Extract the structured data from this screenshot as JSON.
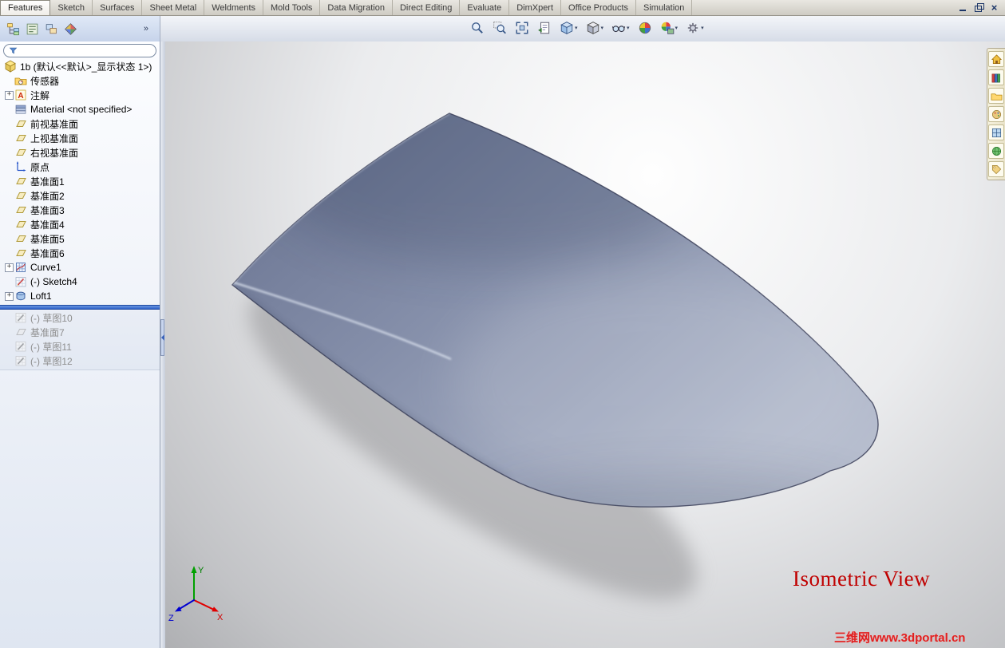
{
  "command_tabs": {
    "items": [
      {
        "label": "Features",
        "active": true
      },
      {
        "label": "Sketch",
        "active": false
      },
      {
        "label": "Surfaces",
        "active": false
      },
      {
        "label": "Sheet Metal",
        "active": false
      },
      {
        "label": "Weldments",
        "active": false
      },
      {
        "label": "Mold Tools",
        "active": false
      },
      {
        "label": "Data Migration",
        "active": false
      },
      {
        "label": "Direct Editing",
        "active": false
      },
      {
        "label": "Evaluate",
        "active": false
      },
      {
        "label": "DimXpert",
        "active": false
      },
      {
        "label": "Office Products",
        "active": false
      },
      {
        "label": "Simulation",
        "active": false
      }
    ]
  },
  "window_controls": {
    "buttons": [
      {
        "name": "minimize-button"
      },
      {
        "name": "restore-button"
      },
      {
        "name": "close-button"
      }
    ]
  },
  "featuremanager_toolbar": {
    "tabs": [
      {
        "name": "featuremanager-design-tree-tab"
      },
      {
        "name": "propertymanager-tab"
      },
      {
        "name": "configurationmanager-tab"
      },
      {
        "name": "displaymanager-tab"
      }
    ],
    "overflow": "»"
  },
  "view_toolbar": {
    "buttons": [
      {
        "name": "zoom-in-out",
        "dropdown": false
      },
      {
        "name": "zoom-to-area",
        "dropdown": false
      },
      {
        "name": "zoom-to-fit",
        "dropdown": false
      },
      {
        "name": "previous-view",
        "dropdown": false
      },
      {
        "name": "view-orientation",
        "dropdown": true
      },
      {
        "name": "display-style",
        "dropdown": true
      },
      {
        "name": "hide-show-items",
        "dropdown": true
      },
      {
        "name": "edit-appearance",
        "dropdown": false
      },
      {
        "name": "apply-scene",
        "dropdown": true
      },
      {
        "name": "view-settings",
        "dropdown": true
      }
    ]
  },
  "feature_tree": {
    "filter_placeholder": "",
    "root": {
      "label": "1b (默认<<默认>_显示状态 1>)",
      "icon": "part"
    },
    "items": [
      {
        "label": "传感器",
        "icon": "sensors",
        "expandable": false
      },
      {
        "label": "注解",
        "icon": "annotations",
        "expandable": true
      },
      {
        "label": "Material <not specified>",
        "icon": "material",
        "expandable": false
      },
      {
        "label": "前视基准面",
        "icon": "plane",
        "expandable": false
      },
      {
        "label": "上视基准面",
        "icon": "plane",
        "expandable": false
      },
      {
        "label": "右视基准面",
        "icon": "plane",
        "expandable": false
      },
      {
        "label": "原点",
        "icon": "origin",
        "expandable": false
      },
      {
        "label": "基准面1",
        "icon": "plane",
        "expandable": false
      },
      {
        "label": "基准面2",
        "icon": "plane",
        "expandable": false
      },
      {
        "label": "基准面3",
        "icon": "plane",
        "expandable": false
      },
      {
        "label": "基准面4",
        "icon": "plane",
        "expandable": false
      },
      {
        "label": "基准面5",
        "icon": "plane",
        "expandable": false
      },
      {
        "label": "基准面6",
        "icon": "plane",
        "expandable": false
      },
      {
        "label": "Curve1",
        "icon": "curve",
        "expandable": true
      },
      {
        "label": "(-) Sketch4",
        "icon": "sketch",
        "expandable": false
      },
      {
        "label": "Loft1",
        "icon": "loft",
        "expandable": true
      }
    ],
    "rolled_back_items": [
      {
        "label": "(-) 草图10",
        "icon": "sketch"
      },
      {
        "label": "基准面7",
        "icon": "plane"
      },
      {
        "label": "(-) 草图11",
        "icon": "sketch"
      },
      {
        "label": "(-) 草图12",
        "icon": "sketch"
      }
    ]
  },
  "taskpane": {
    "icons": [
      {
        "name": "solidworks-resources"
      },
      {
        "name": "design-library"
      },
      {
        "name": "file-explorer"
      },
      {
        "name": "view-palette"
      },
      {
        "name": "appearances"
      },
      {
        "name": "scenes"
      },
      {
        "name": "custom-properties"
      }
    ]
  },
  "viewport": {
    "view_label": "Isometric View",
    "watermark": "三维网www.3dportal.cn",
    "triad": {
      "x_label": "X",
      "y_label": "Y",
      "z_label": "Z"
    }
  },
  "colors": {
    "surface_dark": "#6f7996",
    "surface_light": "#b6bdce",
    "rollback_bar": "#2f62c8",
    "view_label": "#c00000",
    "watermark": "#e02020"
  }
}
